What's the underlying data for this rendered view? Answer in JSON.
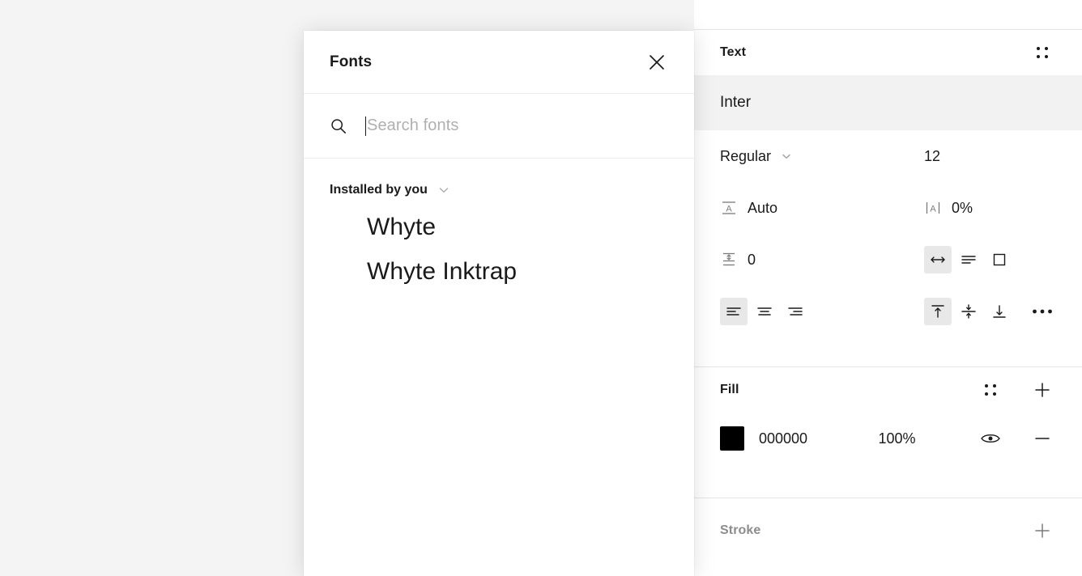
{
  "app": {
    "background_color": "#f4f4f4",
    "panel_background": "#ffffff",
    "accent_selected_bg": "#e8e8e8",
    "row_highlight_bg": "#f2f2f2"
  },
  "fonts_modal": {
    "title": "Fonts",
    "close_icon": "close-icon",
    "search": {
      "icon": "search-icon",
      "placeholder": "Search fonts",
      "value": ""
    },
    "groups": [
      {
        "label": "Installed by you",
        "chevron_icon": "chevron-down-icon",
        "expanded": true,
        "fonts": [
          {
            "name": "Whyte"
          },
          {
            "name": "Whyte Inktrap"
          }
        ]
      }
    ]
  },
  "properties_panel": {
    "sections": [
      {
        "id": "text",
        "title": "Text",
        "title_muted": false,
        "actions": [
          {
            "icon": "text-styles-icon",
            "label": "Text styles"
          }
        ],
        "font_family": "Inter",
        "font_weight": "Regular",
        "font_weight_caret": "chevron-down-icon",
        "font_size": "12",
        "line_height_icon": "line-height-icon",
        "line_height": "Auto",
        "letter_spacing_icon": "letter-spacing-icon",
        "letter_spacing": "0%",
        "paragraph_spacing_icon": "paragraph-spacing-icon",
        "paragraph_spacing": "0",
        "resize_buttons": [
          {
            "icon": "auto-width-icon",
            "label": "Auto width",
            "selected": true
          },
          {
            "icon": "auto-height-icon",
            "label": "Auto height",
            "selected": false
          },
          {
            "icon": "fixed-size-icon",
            "label": "Fixed size",
            "selected": false
          }
        ],
        "horizontal_align_buttons": [
          {
            "icon": "align-left-icon",
            "label": "Align left",
            "selected": true
          },
          {
            "icon": "align-center-icon",
            "label": "Align center",
            "selected": false
          },
          {
            "icon": "align-right-icon",
            "label": "Align right",
            "selected": false
          }
        ],
        "vertical_align_buttons": [
          {
            "icon": "align-top-icon",
            "label": "Align top",
            "selected": true
          },
          {
            "icon": "align-middle-icon",
            "label": "Align middle",
            "selected": false
          },
          {
            "icon": "align-bottom-icon",
            "label": "Align bottom",
            "selected": false
          }
        ],
        "more_options_icon": "more-horizontal-icon"
      },
      {
        "id": "fill",
        "title": "Fill",
        "title_muted": false,
        "style_icon": "fill-styles-icon",
        "add_icon": "plus-icon",
        "items": [
          {
            "swatch_color": "#000000",
            "hex": "000000",
            "opacity": "100%",
            "visibility_icon": "eye-icon",
            "remove_icon": "minus-icon"
          }
        ]
      },
      {
        "id": "stroke",
        "title": "Stroke",
        "title_muted": true,
        "add_icon": "plus-icon",
        "items": []
      }
    ]
  }
}
